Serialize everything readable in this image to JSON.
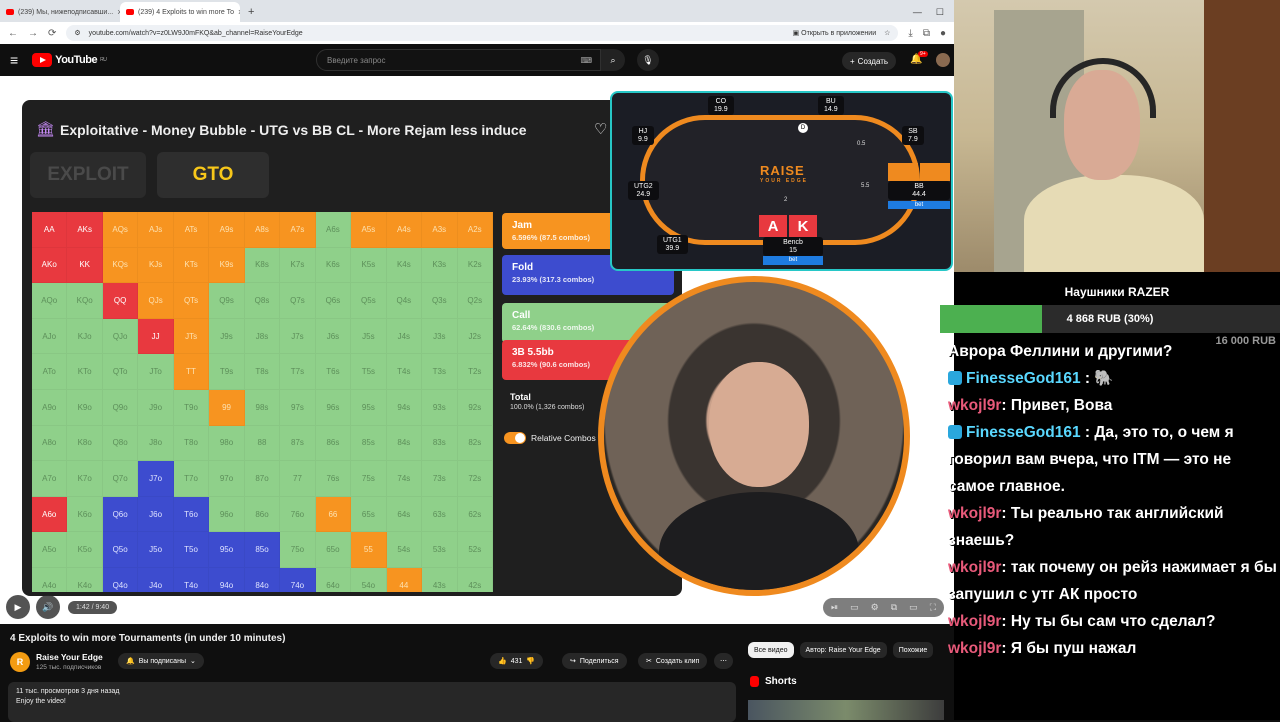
{
  "browser": {
    "tabs": [
      {
        "title": "(239) Мы, нижеподписавши..."
      },
      {
        "title": "(239) 4 Exploits to win more To"
      }
    ],
    "url": "youtube.com/watch?v=z0LW9J0mFKQ&ab_channel=RaiseYourEdge",
    "open_in_app": "Открыть в приложении"
  },
  "youtube": {
    "logo_text": "YouTube",
    "region": "RU",
    "search_placeholder": "Введите запрос",
    "create_label": "Создать",
    "bell_badge": "9+"
  },
  "solver": {
    "title": "Exploitative - Money Bubble - UTG vs BB CL - More Rejam less induce",
    "tab_exploit": "EXPLOIT",
    "tab_gto": "GTO",
    "actions": {
      "jam": {
        "label": "Jam",
        "detail": "6.596% (87.5 combos)"
      },
      "fold": {
        "label": "Fold",
        "detail": "23.93% (317.3 combos)"
      },
      "call": {
        "label": "Call",
        "detail": "62.64% (830.6 combos)"
      },
      "bet3": {
        "label": "3B 5.5bb",
        "detail": "6.832% (90.6 combos)"
      },
      "total": {
        "label": "Total",
        "detail": "100.0% (1,326 combos)"
      }
    },
    "relative_combos_label": "Relative Combos",
    "grid": [
      [
        [
          "AA",
          "r"
        ],
        [
          "AKs",
          "r"
        ],
        [
          "AQs",
          "o"
        ],
        [
          "AJs",
          "o"
        ],
        [
          "ATs",
          "o"
        ],
        [
          "A9s",
          "o"
        ],
        [
          "A8s",
          "o"
        ],
        [
          "A7s",
          "o"
        ],
        [
          "A6s",
          "g"
        ],
        [
          "A5s",
          "o"
        ],
        [
          "A4s",
          "o"
        ],
        [
          "A3s",
          "o"
        ],
        [
          "A2s",
          "o"
        ]
      ],
      [
        [
          "AKo",
          "r"
        ],
        [
          "KK",
          "r"
        ],
        [
          "KQs",
          "o"
        ],
        [
          "KJs",
          "o"
        ],
        [
          "KTs",
          "o"
        ],
        [
          "K9s",
          "o"
        ],
        [
          "K8s",
          "g"
        ],
        [
          "K7s",
          "g"
        ],
        [
          "K6s",
          "g"
        ],
        [
          "K5s",
          "g"
        ],
        [
          "K4s",
          "g"
        ],
        [
          "K3s",
          "g"
        ],
        [
          "K2s",
          "g"
        ]
      ],
      [
        [
          "AQo",
          "g"
        ],
        [
          "KQo",
          "g"
        ],
        [
          "QQ",
          "r"
        ],
        [
          "QJs",
          "o"
        ],
        [
          "QTs",
          "o"
        ],
        [
          "Q9s",
          "g"
        ],
        [
          "Q8s",
          "g"
        ],
        [
          "Q7s",
          "g"
        ],
        [
          "Q6s",
          "g"
        ],
        [
          "Q5s",
          "g"
        ],
        [
          "Q4s",
          "g"
        ],
        [
          "Q3s",
          "g"
        ],
        [
          "Q2s",
          "g"
        ]
      ],
      [
        [
          "AJo",
          "g"
        ],
        [
          "KJo",
          "g"
        ],
        [
          "QJo",
          "g"
        ],
        [
          "JJ",
          "r"
        ],
        [
          "JTs",
          "o"
        ],
        [
          "J9s",
          "g"
        ],
        [
          "J8s",
          "g"
        ],
        [
          "J7s",
          "g"
        ],
        [
          "J6s",
          "g"
        ],
        [
          "J5s",
          "g"
        ],
        [
          "J4s",
          "g"
        ],
        [
          "J3s",
          "g"
        ],
        [
          "J2s",
          "g"
        ]
      ],
      [
        [
          "ATo",
          "g"
        ],
        [
          "KTo",
          "g"
        ],
        [
          "QTo",
          "g"
        ],
        [
          "JTo",
          "g"
        ],
        [
          "TT",
          "o"
        ],
        [
          "T9s",
          "g"
        ],
        [
          "T8s",
          "g"
        ],
        [
          "T7s",
          "g"
        ],
        [
          "T6s",
          "g"
        ],
        [
          "T5s",
          "g"
        ],
        [
          "T4s",
          "g"
        ],
        [
          "T3s",
          "g"
        ],
        [
          "T2s",
          "g"
        ]
      ],
      [
        [
          "A9o",
          "g"
        ],
        [
          "K9o",
          "g"
        ],
        [
          "Q9o",
          "g"
        ],
        [
          "J9o",
          "g"
        ],
        [
          "T9o",
          "g"
        ],
        [
          "99",
          "o"
        ],
        [
          "98s",
          "g"
        ],
        [
          "97s",
          "g"
        ],
        [
          "96s",
          "g"
        ],
        [
          "95s",
          "g"
        ],
        [
          "94s",
          "g"
        ],
        [
          "93s",
          "g"
        ],
        [
          "92s",
          "g"
        ]
      ],
      [
        [
          "A8o",
          "g"
        ],
        [
          "K8o",
          "g"
        ],
        [
          "Q8o",
          "g"
        ],
        [
          "J8o",
          "g"
        ],
        [
          "T8o",
          "g"
        ],
        [
          "98o",
          "g"
        ],
        [
          "88",
          "g"
        ],
        [
          "87s",
          "g"
        ],
        [
          "86s",
          "g"
        ],
        [
          "85s",
          "g"
        ],
        [
          "84s",
          "g"
        ],
        [
          "83s",
          "g"
        ],
        [
          "82s",
          "g"
        ]
      ],
      [
        [
          "A7o",
          "g"
        ],
        [
          "K7o",
          "g"
        ],
        [
          "Q7o",
          "g"
        ],
        [
          "J7o",
          "b"
        ],
        [
          "T7o",
          "g"
        ],
        [
          "97o",
          "g"
        ],
        [
          "87o",
          "g"
        ],
        [
          "77",
          "g"
        ],
        [
          "76s",
          "g"
        ],
        [
          "75s",
          "g"
        ],
        [
          "74s",
          "g"
        ],
        [
          "73s",
          "g"
        ],
        [
          "72s",
          "g"
        ]
      ],
      [
        [
          "A6o",
          "r"
        ],
        [
          "K6o",
          "g"
        ],
        [
          "Q6o",
          "b"
        ],
        [
          "J6o",
          "b"
        ],
        [
          "T6o",
          "b"
        ],
        [
          "96o",
          "g"
        ],
        [
          "86o",
          "g"
        ],
        [
          "76o",
          "g"
        ],
        [
          "66",
          "o"
        ],
        [
          "65s",
          "g"
        ],
        [
          "64s",
          "g"
        ],
        [
          "63s",
          "g"
        ],
        [
          "62s",
          "g"
        ]
      ],
      [
        [
          "A5o",
          "g"
        ],
        [
          "K5o",
          "g"
        ],
        [
          "Q5o",
          "b"
        ],
        [
          "J5o",
          "b"
        ],
        [
          "T5o",
          "b"
        ],
        [
          "95o",
          "b"
        ],
        [
          "85o",
          "b"
        ],
        [
          "75o",
          "g"
        ],
        [
          "65o",
          "g"
        ],
        [
          "55",
          "o"
        ],
        [
          "54s",
          "g"
        ],
        [
          "53s",
          "g"
        ],
        [
          "52s",
          "g"
        ]
      ],
      [
        [
          "A4o",
          "g"
        ],
        [
          "K4o",
          "g"
        ],
        [
          "Q4o",
          "b"
        ],
        [
          "J4o",
          "b"
        ],
        [
          "T4o",
          "b"
        ],
        [
          "94o",
          "b"
        ],
        [
          "84o",
          "b"
        ],
        [
          "74o",
          "b"
        ],
        [
          "64o",
          "g"
        ],
        [
          "54o",
          "g"
        ],
        [
          "44",
          "o"
        ],
        [
          "43s",
          "g"
        ],
        [
          "42s",
          "g"
        ]
      ],
      [
        [
          "A3o",
          "g"
        ],
        [
          "K3o",
          "g"
        ],
        [
          "Q3o",
          "b"
        ],
        [
          "J3o",
          "b"
        ],
        [
          "T3o",
          "b"
        ],
        [
          "93o",
          "b"
        ],
        [
          "83o",
          "b"
        ],
        [
          "73o",
          "b"
        ],
        [
          "63o",
          "g"
        ],
        [
          "53o",
          "g"
        ],
        [
          "43o",
          "g"
        ],
        [
          "33",
          "o"
        ],
        [
          "32s",
          "g"
        ]
      ],
      [
        [
          "A2o",
          "g"
        ],
        [
          "K2o",
          "g"
        ],
        [
          "Q2o",
          "b"
        ],
        [
          "J2o",
          "b"
        ],
        [
          "T2o",
          "b"
        ],
        [
          "92o",
          "b"
        ],
        [
          "82o",
          "b"
        ],
        [
          "72o",
          "b"
        ],
        [
          "62o",
          "g"
        ],
        [
          "52o",
          "g"
        ],
        [
          "42o",
          "g"
        ],
        [
          "32o",
          "g"
        ],
        [
          "22",
          "o"
        ]
      ]
    ]
  },
  "table": {
    "logo": "RAISE",
    "logo_sub": "YOUR EDGE",
    "seats": {
      "co": {
        "name": "CO",
        "stack": "19.9"
      },
      "bu": {
        "name": "BU",
        "stack": "14.9"
      },
      "hj": {
        "name": "HJ",
        "stack": "9.9"
      },
      "sb": {
        "name": "SB",
        "stack": "7.9"
      },
      "utg2": {
        "name": "UTG2",
        "stack": "24.9"
      },
      "bb": {
        "name": "BB",
        "stack": "44.4"
      },
      "utg1": {
        "name": "UTG1",
        "stack": "39.9"
      },
      "hero": {
        "name": "Bencb",
        "stack": "15"
      }
    },
    "dealer": "D",
    "pot": "2",
    "sb_chip": "0.5",
    "bb_chip": "5.5",
    "bet_label": "bet",
    "hero_cards": [
      "A",
      "K"
    ]
  },
  "player": {
    "time": "1:42 / 9:40",
    "progress": 0.18
  },
  "video": {
    "title": "4 Exploits to win more Tournaments (in under 10 minutes)",
    "channel": "Raise Your Edge",
    "subscribers": "125 тыс. подписчиков",
    "subscribed_label": "Вы подписаны",
    "likes": "431",
    "share_label": "Поделиться",
    "clip_label": "Создать клип",
    "views_line": "11 тыс. просмотров  3 дня назад",
    "desc_line": "Enjoy the video!"
  },
  "sidebar": {
    "filters": [
      "Все видео",
      "Автор: Raise Your Edge",
      "Похожие"
    ],
    "shorts_label": "Shorts"
  },
  "donation": {
    "title": "Наушники RAZER",
    "amount": "4 868 RUB (30%)",
    "goal": "16 000 RUB",
    "left": "RUB",
    "progress": 0.3
  },
  "chat": [
    {
      "nick": "",
      "text": "Аврора Феллини и другими?"
    },
    {
      "nick": "FinesseGod161",
      "text": " : 🐘",
      "color": "fg"
    },
    {
      "nick": "wkojl9r",
      "text": ": Привет, Вова",
      "color": "wk"
    },
    {
      "nick": "FinesseGod161",
      "text": " : Да, это то, о чем я говорил вам вчера, что ITM — это не самое главное.",
      "color": "fg"
    },
    {
      "nick": "wkojl9r",
      "text": ": Ты реально так английский знаешь?",
      "color": "wk"
    },
    {
      "nick": "wkojl9r",
      "text": ": так почему он рейз нажимает я бы запушил с утг АК просто",
      "color": "wk"
    },
    {
      "nick": "wkojl9r",
      "text": ": Ну ты бы сам что сделал?",
      "color": "wk"
    },
    {
      "nick": "wkojl9r",
      "text": ": Я бы пуш нажал",
      "color": "wk"
    }
  ]
}
